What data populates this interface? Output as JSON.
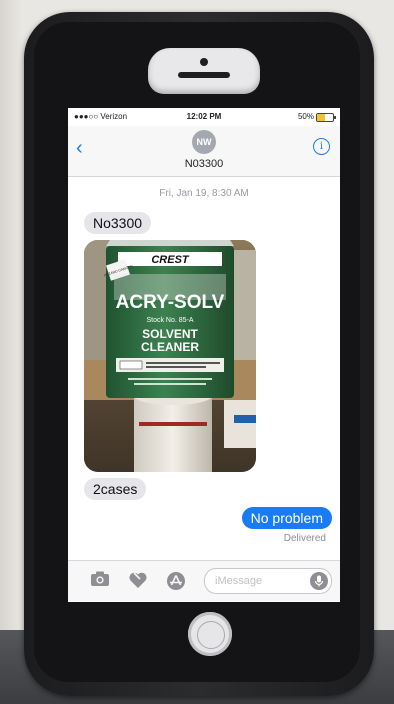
{
  "status_bar": {
    "carrier": "●●●○○ Verizon",
    "time": "12:02 PM",
    "battery_percent": "50%",
    "battery_level": 0.5
  },
  "header": {
    "back_icon": "chevron-left-icon",
    "avatar_initials": "NW",
    "contact_name": "N03300",
    "info_icon": "info-icon"
  },
  "conversation": {
    "date_stamp": "Fri, Jan 19, 8:30 AM",
    "messages": [
      {
        "direction": "incoming",
        "type": "text",
        "text": "No3300"
      },
      {
        "direction": "incoming",
        "type": "photo",
        "photo_text": {
          "brand": "CREST",
          "sticker": "HAZARD DANGER",
          "product": "ACRY-SOLV",
          "stock": "Stock No. 85-A",
          "line1": "SOLVENT",
          "line2": "CLEANER"
        }
      },
      {
        "direction": "incoming",
        "type": "text",
        "text": "2cases"
      },
      {
        "direction": "outgoing",
        "type": "text",
        "text": "No problem"
      }
    ],
    "delivered_label": "Delivered"
  },
  "input_bar": {
    "placeholder": "iMessage",
    "camera_icon": "camera-icon",
    "digital_touch_icon": "heart-touch-icon",
    "app_store_icon": "app-store-icon",
    "mic_icon": "microphone-icon"
  },
  "colors": {
    "imessage_blue": "#1a7cf5",
    "incoming_bubble": "#e5e5ea",
    "can_green": "#2f6b3e"
  }
}
